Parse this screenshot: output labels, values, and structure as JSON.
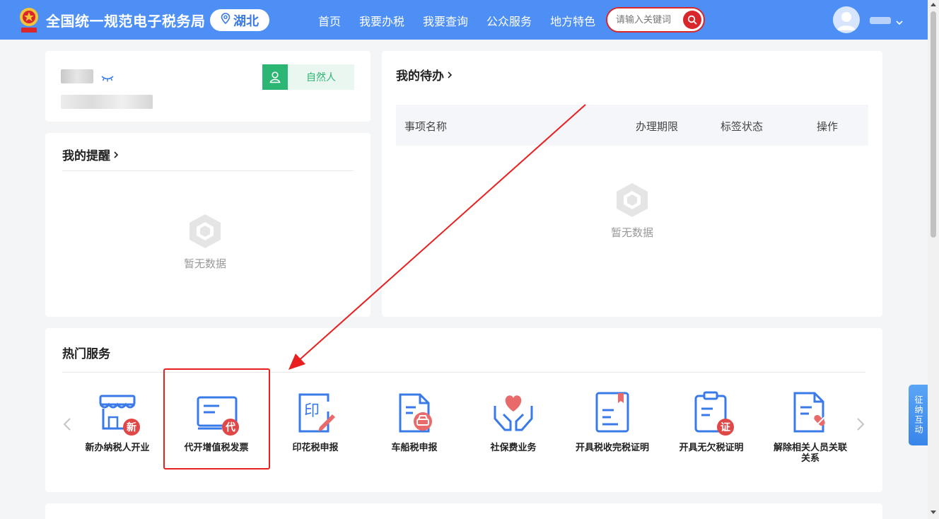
{
  "header": {
    "site_title": "全国统一规范电子税务局",
    "region": "湖北",
    "nav": [
      "首页",
      "我要办税",
      "我要查询",
      "公众服务",
      "地方特色"
    ],
    "search_placeholder": "请输入关键词"
  },
  "profile": {
    "role": "自然人"
  },
  "reminders": {
    "title": "我的提醒",
    "empty_text": "暂无数据"
  },
  "todo": {
    "title": "我的待办",
    "columns": [
      "事项名称",
      "办理期限",
      "标签状态",
      "操作"
    ],
    "empty_text": "暂无数据"
  },
  "hot_services": {
    "title": "热门服务",
    "items": [
      {
        "label": "新办纳税人开业",
        "badge": "新",
        "icon": "store-icon"
      },
      {
        "label": "代开增值税发票",
        "badge": "代",
        "icon": "invoice-icon"
      },
      {
        "label": "印花税申报",
        "badge": "",
        "icon": "stamp-tax-icon"
      },
      {
        "label": "车船税申报",
        "badge": "",
        "icon": "vehicle-tax-icon"
      },
      {
        "label": "社保费业务",
        "badge": "",
        "icon": "heart-hands-icon"
      },
      {
        "label": "开具税收完税证明",
        "badge": "",
        "icon": "certificate-icon"
      },
      {
        "label": "开具无欠税证明",
        "badge": "证",
        "icon": "clipboard-icon"
      },
      {
        "label": "解除相关人员关联关系",
        "badge": "",
        "icon": "unlink-document-icon"
      }
    ]
  },
  "side_float": {
    "label": "征纳互动"
  },
  "colors": {
    "header": "#4e8ff5",
    "accent_red": "#e82020",
    "green": "#2bb673"
  }
}
